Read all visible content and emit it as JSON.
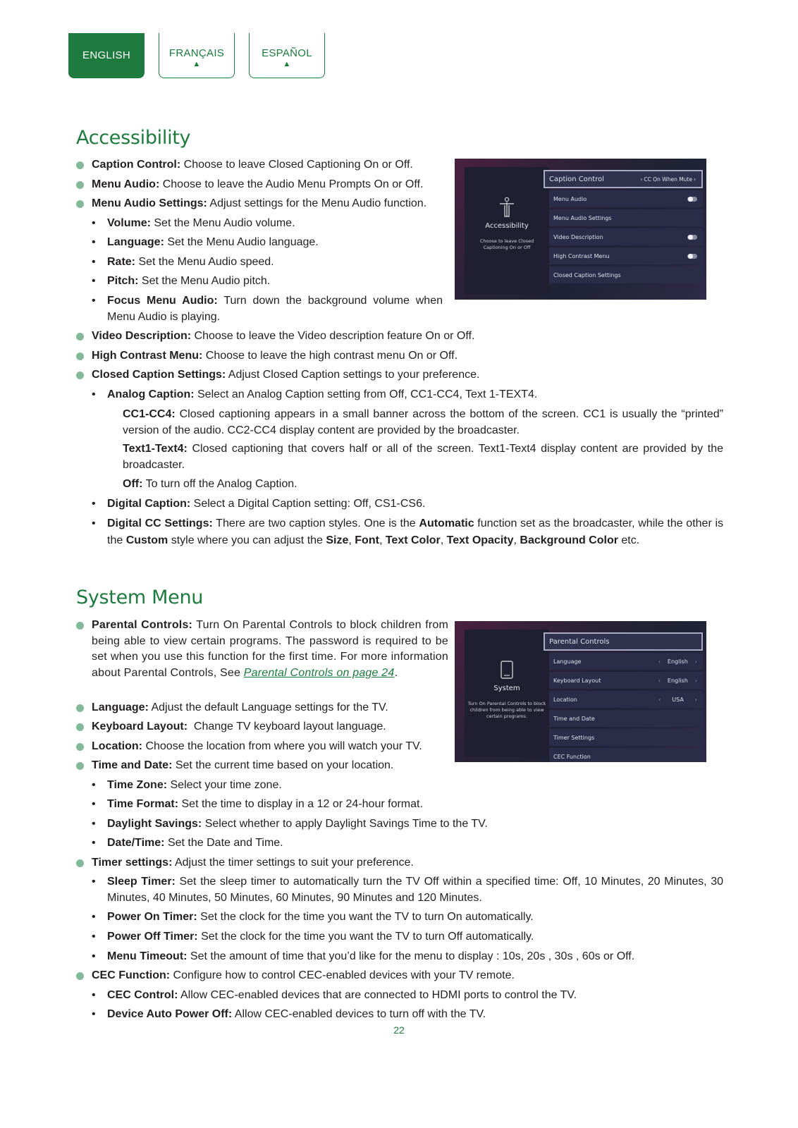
{
  "lang_tabs": [
    {
      "label": "ENGLISH",
      "active": true
    },
    {
      "label": "FRANÇAIS",
      "arrow": "▲"
    },
    {
      "label": "ESPAÑOL",
      "arrow": "▲"
    }
  ],
  "accessibility": {
    "title": "Accessibility",
    "items": [
      {
        "term": "Caption Control:",
        "text": " Choose to leave Closed Captioning On or Off."
      },
      {
        "term": "Menu Audio:",
        "text": " Choose to leave the Audio Menu Prompts On or Off."
      },
      {
        "term": "Menu Audio Settings:",
        "text": " Adjust settings for the Menu Audio function."
      },
      {
        "term": "Volume:",
        "text": " Set the Menu Audio volume."
      },
      {
        "term": "Language:",
        "text": " Set the Menu Audio language."
      },
      {
        "term": "Rate:",
        "text": " Set the Menu Audio speed."
      },
      {
        "term": "Pitch:",
        "text": " Set the Menu Audio pitch."
      },
      {
        "term": "Focus Menu Audio:",
        "text": " Turn down the background volume when Menu Audio is playing."
      },
      {
        "term": "Video Description:",
        "text": " Choose to leave the Video description feature On or Off."
      },
      {
        "term": "High Contrast Menu:",
        "text": " Choose to leave the high contrast menu On or Off."
      },
      {
        "term": "Closed Caption Settings:",
        "text": " Adjust Closed Caption settings to your preference."
      },
      {
        "term": "Analog Caption:",
        "text": " Select an Analog Caption setting from Off, CC1-CC4, Text 1-TEXT4."
      },
      {
        "term": "CC1-CC4:",
        "text": " Closed captioning appears in a small banner across the bottom of the screen. CC1 is usually the “printed” version of the audio. CC2-CC4 display content are provided by the broadcaster."
      },
      {
        "term": "Text1-Text4:",
        "text": " Closed captioning that covers half or all of the screen. Text1-Text4 display content are provided by the broadcaster."
      },
      {
        "term": "Off:",
        "text": " To turn off the Analog Caption."
      },
      {
        "term": "Digital Caption:",
        "text": " Select a Digital Caption setting: Off, CS1-CS6."
      },
      {
        "term": "Digital CC Settings:",
        "text_a": " There are two caption styles. One is the ",
        "b1": "Automatic",
        "text_b": " function set as the broadcaster, while the other is the ",
        "b2": "Custom",
        "text_c": " style where you can adjust the ",
        "b3": "Size",
        "s1": ", ",
        "b4": "Font",
        "s2": ", ",
        "b5": "Text Color",
        "s3": ", ",
        "b6": "Text Opacity",
        "s4": ", ",
        "b7": "Background Color",
        "text_d": " etc."
      }
    ],
    "tv": {
      "panel_title": "Accessibility",
      "panel_desc": "Choose to leave Closed Captioning On or Off",
      "selected": {
        "label": "Caption Control",
        "value": "CC On When Mute"
      },
      "menu": [
        {
          "label": "Menu Audio",
          "toggle": true
        },
        {
          "label": "Menu Audio Settings"
        },
        {
          "label": "Video Description",
          "toggle": true
        },
        {
          "label": "High Contrast Menu",
          "toggle": true
        },
        {
          "label": "Closed Caption Settings"
        }
      ]
    }
  },
  "system": {
    "title": "System Menu",
    "items": [
      {
        "term": "Parental Controls:",
        "text": " Turn On Parental Controls to block children from being able to view certain programs. The password is required to be set when you use this function for the first time. For more information about Parental Controls, See ",
        "link": "Parental Controls on page 24",
        "end": "."
      },
      {
        "term": "Language:",
        "text": " Adjust the default Language settings for the TV."
      },
      {
        "term": "Keyboard Layout:",
        "text": "  Change TV keyboard layout language."
      },
      {
        "term": "Location:",
        "text": " Choose the location from where you will watch your TV."
      },
      {
        "term": "Time and Date:",
        "text": " Set the current time based on your location."
      },
      {
        "term": "Time Zone:",
        "text": " Select your time zone."
      },
      {
        "term": "Time Format:",
        "text": " Set the time to display in a 12 or 24-hour format."
      },
      {
        "term": "Daylight Savings:",
        "text": " Select whether to apply Daylight Savings Time to the TV."
      },
      {
        "term": "Date/Time:",
        "text": " Set the Date and Time."
      },
      {
        "term": "Timer settings:",
        "text": " Adjust the timer settings to suit your preference."
      },
      {
        "term": "Sleep Timer:",
        "text": " Set the sleep timer to automatically turn the TV Off within a specified time: Off, 10 Minutes, 20 Minutes, 30 Minutes, 40 Minutes, 50 Minutes, 60 Minutes, 90 Minutes and 120 Minutes."
      },
      {
        "term": "Power On Timer:",
        "text": " Set the clock for the time you want the TV to turn On automatically."
      },
      {
        "term": "Power Off Timer:",
        "text": " Set the clock for the time you want the TV to turn Off automatically."
      },
      {
        "term": "Menu Timeout:",
        "text": " Set the amount of time that you’d like for the menu to display : 10s, 20s , 30s , 60s or Off."
      },
      {
        "term": "CEC Function:",
        "text": " Configure how to control CEC-enabled devices with your TV remote."
      },
      {
        "term": "CEC Control:",
        "text": " Allow CEC-enabled devices that are connected to HDMI ports to control the TV."
      },
      {
        "term": "Device Auto Power Off:",
        "text": " Allow CEC-enabled devices to turn off with the TV."
      }
    ],
    "tv": {
      "panel_title": "System",
      "panel_desc": "Turn On Parental Controls to block children from being able to view certain programs.",
      "selected": {
        "label": "Parental Controls"
      },
      "menu": [
        {
          "label": "Language",
          "value": "English"
        },
        {
          "label": "Keyboard Layout",
          "value": "English"
        },
        {
          "label": "Location",
          "value": "USA"
        },
        {
          "label": "Time and Date"
        },
        {
          "label": "Timer Settings"
        },
        {
          "label": "CEC Function"
        }
      ]
    }
  },
  "page_number": "22"
}
